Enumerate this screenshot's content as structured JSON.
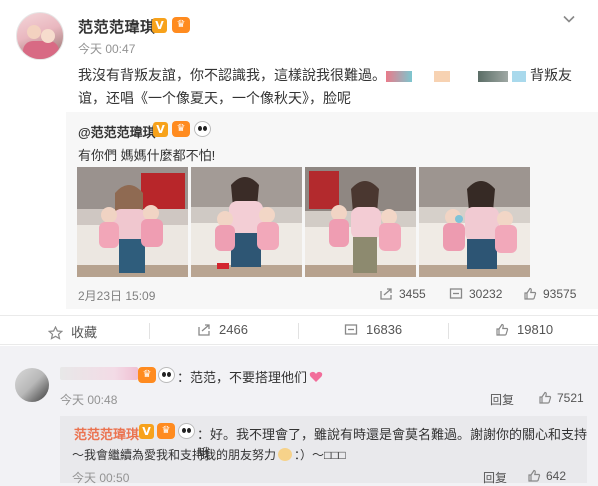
{
  "post": {
    "username": "范范范瑋琪",
    "verified_badge": "V",
    "time": "今天 00:47",
    "text_line1": "我沒有背叛友誼，你不認識我，這樣說我很難過。",
    "text_line1_tail": "背叛友",
    "text_line2": "谊，还唱《一个像夏天，一个像秋天》，脸呢",
    "icons": [
      "avatar",
      "verified-icon",
      "crown-icon",
      "chevron-down-icon"
    ]
  },
  "repost": {
    "username": "@范范范瑋琪",
    "verified_badge": "V",
    "text": "有你們 媽媽什麼都不怕!",
    "time": "2月23日 15:09",
    "share_count": "3455",
    "comment_count": "30232",
    "like_count": "93575",
    "photo_count": 4
  },
  "actions": {
    "favorite_label": "收藏",
    "share_count": "2466",
    "comment_count": "16836",
    "like_count": "19810"
  },
  "comment": {
    "text": "：范范，不要搭理他们",
    "time": "今天 00:48",
    "reply_label": "回复",
    "like_count": "7521"
  },
  "reply": {
    "username": "范范范瑋琪",
    "verified_badge": "V",
    "text_line1": "：好。我不理會了，雖說有時還是會莫名難過。謝謝你的關心和支持哦",
    "text_line2": "～我會繼續為愛我和支持我的朋友努力",
    "text_line2_tail": "：）～□□□",
    "time": "今天 00:50",
    "reply_label": "回复",
    "like_count": "642"
  },
  "colors": {
    "accent": "#eb7350",
    "text": "#333333",
    "muted": "#939393",
    "badge": "#f7a21b",
    "background": "#f2f2f5"
  }
}
